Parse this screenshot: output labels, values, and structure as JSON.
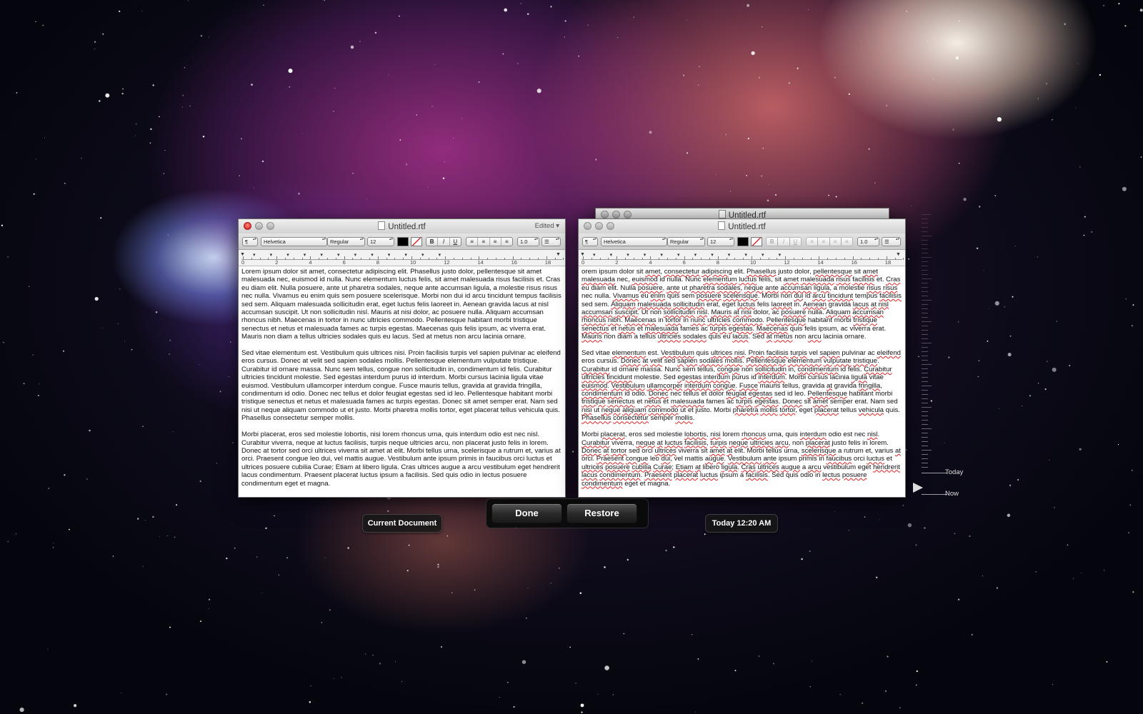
{
  "current_window": {
    "title": "Untitled.rtf",
    "status": "Edited"
  },
  "restore_window": {
    "title": "Untitled.rtf",
    "stack_title": "Untitled.rtf"
  },
  "toolbar": {
    "paragraph_style": "¶",
    "font_family": "Helvetica",
    "font_style": "Regular",
    "font_size": "12",
    "bold": "B",
    "italic": "I",
    "underline": "U",
    "line_spacing": "1.0",
    "list": "☰"
  },
  "ruler": {
    "numbers": [
      "0",
      "2",
      "4",
      "6",
      "8",
      "10",
      "12",
      "14",
      "16",
      "18"
    ]
  },
  "current_document": {
    "paragraphs": [
      "Lorem ipsum dolor sit amet, consectetur adipiscing elit. Phasellus justo dolor, pellentesque sit amet malesuada nec, euismod id nulla. Nunc elementum luctus felis, sit amet malesuada risus facilisis et. Cras eu diam elit. Nulla posuere, ante ut pharetra sodales, neque ante accumsan ligula, a molestie risus risus nec nulla. Vivamus eu enim quis sem posuere scelerisque. Morbi non dui id arcu tincidunt tempus facilisis sed sem. Aliquam malesuada sollicitudin erat, eget luctus felis laoreet in. Aenean gravida lacus at nisl accumsan suscipit. Ut non sollicitudin nisl. Mauris at nisi dolor, ac posuere nulla. Aliquam accumsan rhoncus nibh. Maecenas in tortor in nunc ultricies commodo. Pellentesque habitant morbi tristique senectus et netus et malesuada fames ac turpis egestas. Maecenas quis felis ipsum, ac viverra erat. Mauris non diam a tellus ultricies sodales quis eu lacus. Sed at metus non arcu lacinia ornare.",
      "Sed vitae elementum est. Vestibulum quis ultrices nisi. Proin facilisis turpis vel sapien pulvinar ac eleifend eros cursus. Donec at velit sed sapien sodales mollis. Pellentesque elementum vulputate tristique. Curabitur id ornare massa. Nunc sem tellus, congue non sollicitudin in, condimentum id felis. Curabitur ultricies tincidunt molestie. Sed egestas interdum purus id interdum. Morbi cursus lacinia ligula vitae euismod. Vestibulum ullamcorper interdum congue. Fusce mauris tellus, gravida at gravida fringilla, condimentum id odio. Donec nec tellus et dolor feugiat egestas sed id leo. Pellentesque habitant morbi tristique senectus et netus et malesuada fames ac turpis egestas. Donec sit amet semper erat. Nam sed nisi ut neque aliquam commodo ut et justo. Morbi pharetra mollis tortor, eget placerat tellus vehicula quis. Phasellus consectetur semper mollis.",
      "Morbi placerat, eros sed molestie lobortis, nisi lorem rhoncus urna, quis interdum odio est nec nisl. Curabitur viverra, neque at luctus facilisis, turpis neque ultricies arcu, non placerat justo felis in lorem. Donec at tortor sed orci ultrices viverra sit amet at elit. Morbi tellus urna, scelerisque a rutrum et, varius at orci. Praesent congue leo dui, vel mattis augue. Vestibulum ante ipsum primis in faucibus orci luctus et ultrices posuere cubilia Curae; Etiam at libero ligula. Cras ultrices augue a arcu vestibulum eget hendrerit lacus condimentum. Praesent placerat luctus ipsum a facilisis. Sed quis odio in lectus posuere condimentum eget et magna."
    ]
  },
  "restore_document": {
    "paragraphs": [
      "orem ipsum dolor sit amet, consectetur adipiscing elit. Phasellus justo dolor, pellentesque sit amet malesuada nec, euismod id nulla. Nunc elementum luctus felis, sit amet malesuada risus facilisis et. Cras eu diam elit. Nulla posuere, ante ut pharetra sodales, neque ante accumsan ligula, a molestie risus risus nec nulla. Vivamus eu enim quis sem posuere scelerisque. Morbi non dui id arcu tincidunt tempus facilisis sed sem. Aliquam malesuada sollicitudin erat, eget luctus felis laoreet in. Aenean gravida lacus at nisl accumsan suscipit. Ut non sollicitudin nisl. Mauris at nisi dolor, ac posuere nulla. Aliquam accumsan rhoncus nibh. Maecenas in tortor in nunc ultricies commodo. Pellentesque habitant morbi tristique senectus et netus et malesuada fames ac turpis egestas. Maecenas quis felis ipsum, ac viverra erat. Mauris non diam a tellus ultricies sodales quis eu lacus. Sed at metus non arcu lacinia ornare.",
      "Sed vitae elementum est. Vestibulum quis ultrices nisi. Proin facilisis turpis vel sapien pulvinar ac eleifend eros cursus. Donec at velit sed sapien sodales mollis. Pellentesque elementum vulputate tristique. Curabitur id ornare massa. Nunc sem tellus, congue non sollicitudin in, condimentum id felis. Curabitur ultricies tincidunt molestie. Sed egestas interdum purus id interdum. Morbi cursus lacinia ligula vitae euismod. Vestibulum ullamcorper interdum congue. Fusce mauris tellus, gravida at gravida fringilla, condimentum id odio. Donec nec tellus et dolor feugiat egestas sed id leo. Pellentesque habitant morbi tristique senectus et netus et malesuada fames ac turpis egestas. Donec sit amet semper erat. Nam sed nisi ut neque aliquam commodo ut et justo. Morbi pharetra mollis tortor, eget placerat tellus vehicula quis. Phasellus consectetur semper mollis.",
      "Morbi placerat, eros sed molestie lobortis, nisi lorem rhoncus urna, quis interdum odio est nec nisl. Curabitur viverra, neque at luctus facilisis, turpis neque ultricies arcu, non placerat justo felis in lorem. Donec at tortor sed orci ultrices viverra sit amet at elit. Morbi tellus urna, scelerisque a rutrum et, varius at orci. Praesent congue leo dui, vel mattis augue. Vestibulum ante ipsum primis in faucibus orci luctus et ultrices posuere cubilia Curae; Etiam at libero ligula. Cras ultrices augue a arcu vestibulum eget hendrerit lacus condimentum. Praesent placerat luctus ipsum a facilisis. Sed quis odio in lectus posuere condimentum eget et magna."
    ]
  },
  "labels": {
    "current_document": "Current Document",
    "restore_timestamp": "Today 12:20 AM"
  },
  "buttons": {
    "done": "Done",
    "restore": "Restore"
  },
  "timeline": {
    "today_label": "Today",
    "now_label": "Now"
  },
  "colors": {
    "close_red": "#d7302a",
    "hud_background": "#161616"
  }
}
